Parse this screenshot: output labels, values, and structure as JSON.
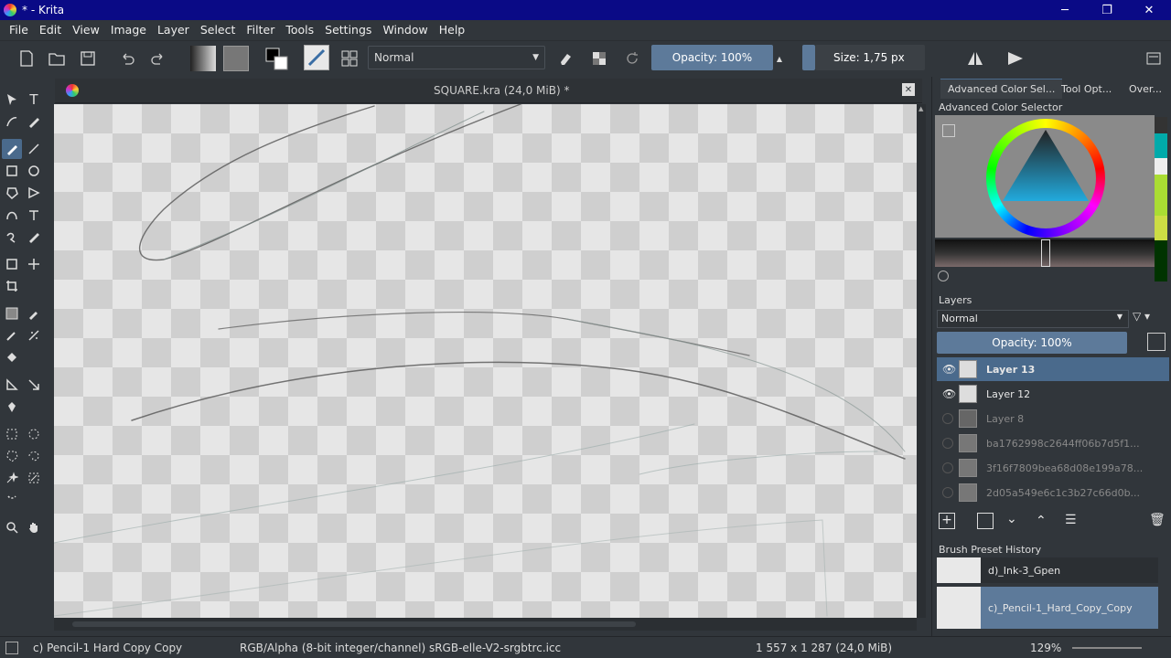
{
  "window": {
    "title": "* - Krita",
    "minimize": "─",
    "maximize": "❐",
    "close": "✕"
  },
  "menu": [
    "File",
    "Edit",
    "View",
    "Image",
    "Layer",
    "Select",
    "Filter",
    "Tools",
    "Settings",
    "Window",
    "Help"
  ],
  "toolbar": {
    "blend_mode": "Normal",
    "opacity_label": "Opacity: 100%",
    "size_label": "Size: 1,75 px"
  },
  "document": {
    "tab_title": "SQUARE.kra (24,0 MiB) *",
    "close": "✕"
  },
  "right_panel": {
    "tabs": [
      "Advanced Color Sel...",
      "Tool Opt...",
      "Over..."
    ],
    "color_selector_title": "Advanced Color Selector",
    "layers_title": "Layers",
    "layers_blend": "Normal",
    "layers_opacity": "Opacity:  100%",
    "layers": [
      {
        "name": "Layer 13",
        "visible": true,
        "selected": true
      },
      {
        "name": "Layer 12",
        "visible": true,
        "selected": false
      },
      {
        "name": "Layer 8",
        "visible": false,
        "selected": false
      },
      {
        "name": "ba1762998c2644ff06b7d5f1...",
        "visible": false,
        "selected": false
      },
      {
        "name": "3f16f7809bea68d08e199a78...",
        "visible": false,
        "selected": false
      },
      {
        "name": "2d05a549e6c1c3b27c66d0b...",
        "visible": false,
        "selected": false
      }
    ],
    "brush_history_title": "Brush Preset History",
    "brush_history": [
      "d)_Ink-3_Gpen",
      "c)_Pencil-1_Hard_Copy_Copy"
    ]
  },
  "status": {
    "brush": "c) Pencil-1 Hard Copy Copy",
    "color_space": "RGB/Alpha (8-bit integer/channel)  sRGB-elle-V2-srgbtrc.icc",
    "dimensions": "1 557 x 1 287 (24,0 MiB)",
    "zoom": "129%"
  },
  "colors": {
    "accent": "#5d7a9a",
    "titlebar": "#0a0a86",
    "panel": "#31363b",
    "selected_layer": "#4a6a8c"
  }
}
